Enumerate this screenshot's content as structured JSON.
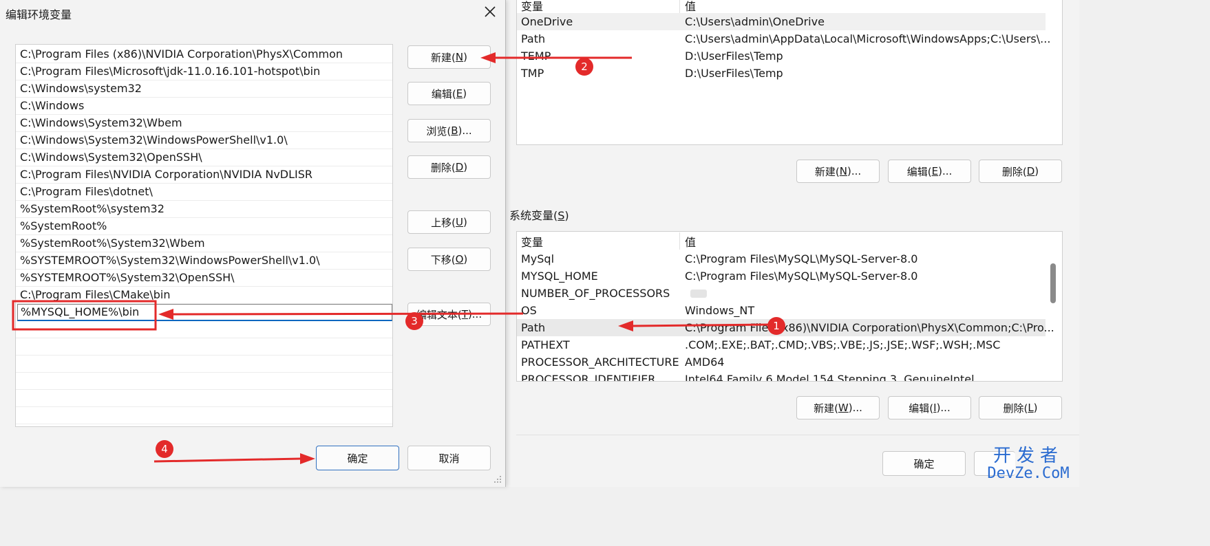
{
  "edit_dialog": {
    "title": "编辑环境变量",
    "path_entries": [
      "C:\\Program Files (x86)\\NVIDIA Corporation\\PhysX\\Common",
      "C:\\Program Files\\Microsoft\\jdk-11.0.16.101-hotspot\\bin",
      "C:\\Windows\\system32",
      "C:\\Windows",
      "C:\\Windows\\System32\\Wbem",
      "C:\\Windows\\System32\\WindowsPowerShell\\v1.0\\",
      "C:\\Windows\\System32\\OpenSSH\\",
      "C:\\Program Files\\NVIDIA Corporation\\NVIDIA NvDLISR",
      "C:\\Program Files\\dotnet\\",
      "%SystemRoot%\\system32",
      "%SystemRoot%",
      "%SystemRoot%\\System32\\Wbem",
      "%SYSTEMROOT%\\System32\\WindowsPowerShell\\v1.0\\",
      "%SYSTEMROOT%\\System32\\OpenSSH\\",
      "C:\\Program Files\\CMake\\bin"
    ],
    "editing_value": "%MYSQL_HOME%\\bin",
    "buttons": {
      "new": {
        "text": "新建(",
        "key": "N",
        "end": ")"
      },
      "edit": {
        "text": "编辑(",
        "key": "E",
        "end": ")"
      },
      "browse": {
        "text": "浏览(",
        "key": "B",
        "end": ")..."
      },
      "delete": {
        "text": "删除(",
        "key": "D",
        "end": ")"
      },
      "move_up": {
        "text": "上移(",
        "key": "U",
        "end": ")"
      },
      "move_down": {
        "text": "下移(",
        "key": "O",
        "end": ")"
      },
      "edit_text": {
        "text": "编辑文本(",
        "key": "T",
        "end": ")..."
      },
      "ok": "确定",
      "cancel": "取消"
    }
  },
  "env_dialog": {
    "user_vars": {
      "header_name": "变量",
      "header_value": "值",
      "rows": [
        {
          "name": "OneDrive",
          "value": "C:\\Users\\admin\\OneDrive"
        },
        {
          "name": "Path",
          "value": "C:\\Users\\admin\\AppData\\Local\\Microsoft\\WindowsApps;C:\\Users\\..."
        },
        {
          "name": "TEMP",
          "value": "D:\\UserFiles\\Temp"
        },
        {
          "name": "TMP",
          "value": "D:\\UserFiles\\Temp"
        }
      ],
      "buttons": {
        "new": {
          "text": "新建(",
          "key": "N",
          "end": ")..."
        },
        "edit": {
          "text": "编辑(",
          "key": "E",
          "end": ")..."
        },
        "delete": {
          "text": "删除(",
          "key": "D",
          "end": ")"
        }
      }
    },
    "system_vars": {
      "label": {
        "text": "系统变量(",
        "key": "S",
        "end": ")"
      },
      "header_name": "变量",
      "header_value": "值",
      "rows": [
        {
          "name": "MySql",
          "value": "C:\\Program Files\\MySQL\\MySQL-Server-8.0"
        },
        {
          "name": "MYSQL_HOME",
          "value": "C:\\Program Files\\MySQL\\MySQL-Server-8.0"
        },
        {
          "name": "NUMBER_OF_PROCESSORS",
          "value": ""
        },
        {
          "name": "OS",
          "value": "Windows_NT"
        },
        {
          "name": "Path",
          "value": "C:\\Program Files (x86)\\NVIDIA Corporation\\PhysX\\Common;C:\\Pro..."
        },
        {
          "name": "PATHEXT",
          "value": ".COM;.EXE;.BAT;.CMD;.VBS;.VBE;.JS;.JSE;.WSF;.WSH;.MSC"
        },
        {
          "name": "PROCESSOR_ARCHITECTURE",
          "value": "AMD64"
        },
        {
          "name": "PROCESSOR_IDENTIFIER",
          "value": "Intel64 Family 6 Model 154 Stepping 3, GenuineIntel"
        }
      ],
      "buttons": {
        "new": {
          "text": "新建(",
          "key": "W",
          "end": ")..."
        },
        "edit": {
          "text": "编辑(",
          "key": "I",
          "end": ")..."
        },
        "delete": {
          "text": "删除(",
          "key": "L",
          "end": ")"
        }
      }
    },
    "ok": "确定"
  },
  "annotations": [
    "1",
    "2",
    "3",
    "4"
  ],
  "watermark": {
    "line1": "开发者",
    "line2": "DevZe.CoM"
  },
  "colors": {
    "annotation_red": "#e32a2a",
    "focus_blue": "#0067c0",
    "watermark_blue": "#2a6bd0"
  }
}
